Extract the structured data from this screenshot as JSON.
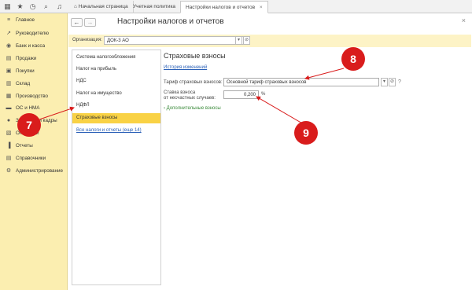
{
  "tabs": [
    {
      "label": "Начальная страница"
    },
    {
      "label": "Учетная политика"
    },
    {
      "label": "Настройки налогов и отчетов"
    }
  ],
  "sidebar": {
    "items": [
      {
        "label": "Главное",
        "icon": "menu-icon"
      },
      {
        "label": "Руководителю",
        "icon": "trend-icon"
      },
      {
        "label": "Банк и касса",
        "icon": "bank-icon"
      },
      {
        "label": "Продажи",
        "icon": "sales-icon"
      },
      {
        "label": "Покупки",
        "icon": "cart-icon"
      },
      {
        "label": "Склад",
        "icon": "warehouse-icon"
      },
      {
        "label": "Производство",
        "icon": "factory-icon"
      },
      {
        "label": "ОС и НМА",
        "icon": "assets-icon"
      },
      {
        "label": "Зарплата и кадры",
        "icon": "people-icon"
      },
      {
        "label": "Операции",
        "icon": "operations-icon"
      },
      {
        "label": "Отчеты",
        "icon": "reports-icon"
      },
      {
        "label": "Справочники",
        "icon": "books-icon"
      },
      {
        "label": "Администрирование",
        "icon": "gear-icon"
      }
    ]
  },
  "main": {
    "title": "Настройки налогов и отчетов",
    "org_label": "Организация:",
    "org_value": "ДОК-3 АО"
  },
  "nav": {
    "items": [
      {
        "label": "Система налогообложения"
      },
      {
        "label": "Налог на прибыль"
      },
      {
        "label": "НДС"
      },
      {
        "label": "Налог на имущество"
      },
      {
        "label": "НДФЛ"
      },
      {
        "label": "Страховые взносы"
      }
    ],
    "all_link": "Все налоги и отчеты (еще 14)"
  },
  "content": {
    "section_title": "Страховые взносы",
    "history_link": "История изменений",
    "tariff_label": "Тариф страховых взносов:",
    "tariff_value": "Основной тариф страховых взносов",
    "rate_label_1": "Ставка взноса",
    "rate_label_2": "от несчастных случаев:",
    "rate_value": "0,200",
    "rate_unit": "%",
    "extra_link": "Дополнительные взносы"
  },
  "callouts": {
    "c7": "7",
    "c8": "8",
    "c9": "9"
  },
  "colors": {
    "sidebar_bg": "#fbeeb0",
    "selected": "#f9d245",
    "callout": "#d91c1c",
    "link": "#2a60b7"
  }
}
